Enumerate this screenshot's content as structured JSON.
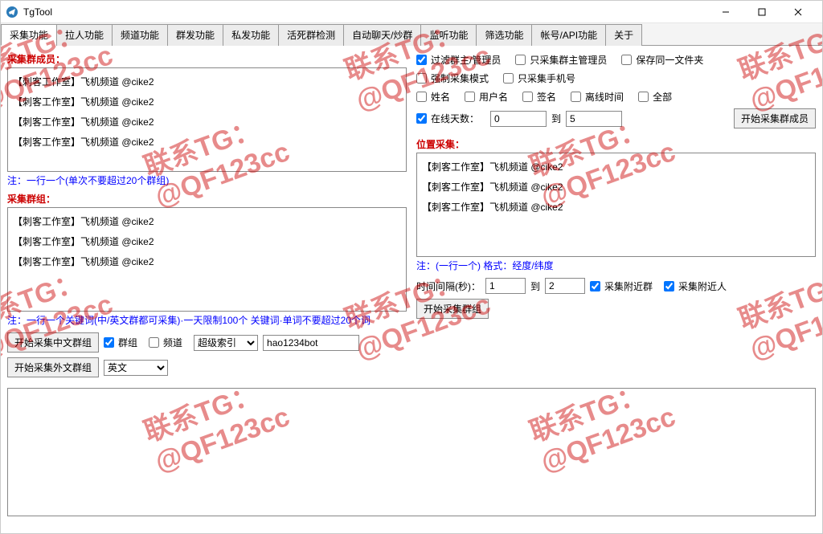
{
  "title": "TgTool",
  "tabs": [
    "采集功能",
    "拉人功能",
    "频道功能",
    "群发功能",
    "私发功能",
    "活死群检测",
    "自动聊天/炒群",
    "监听功能",
    "筛选功能",
    "帐号/API功能",
    "关于"
  ],
  "left": {
    "label_members": "采集群成员：",
    "list1_items": [
      "【刺客工作室】飞机频道 @cike2",
      "【刺客工作室】飞机频道 @cike2",
      "【刺客工作室】飞机频道 @cike2",
      "【刺客工作室】飞机频道 @cike2"
    ],
    "note1": "注：一行一个(单次不要超过20个群组)",
    "label_groups": "采集群组：",
    "list2_items": [
      "【刺客工作室】飞机频道 @cike2",
      "【刺客工作室】飞机频道 @cike2",
      "【刺客工作室】飞机频道 @cike2"
    ],
    "note2": "注：一行一个关键词(中/英文群都可采集)·一天限制100个 关键词·单词不要超过20个词",
    "btn_cn": "开始采集中文群组",
    "btn_en": "开始采集外文群组",
    "chk_group": "群组",
    "chk_channel": "频道",
    "sel_index": "超级索引",
    "bot_value": "hao1234bot",
    "lang_value": "英文"
  },
  "right": {
    "chk_filter_admin": "过滤群主/管理员",
    "chk_only_admin": "只采集群主管理员",
    "chk_same_folder": "保存同一文件夹",
    "chk_force": "强制采集模式",
    "chk_only_phone": "只采集手机号",
    "chk_name": "姓名",
    "chk_username": "用户名",
    "chk_signature": "签名",
    "chk_offline": "离线时间",
    "chk_all": "全部",
    "chk_online_days": "在线天数：",
    "days_from": "0",
    "days_to_label": "到",
    "days_to": "5",
    "btn_start_members": "开始采集群成员",
    "label_location": "位置采集：",
    "list3_items": [
      "【刺客工作室】飞机频道 @cike2",
      "【刺客工作室】飞机频道 @cike2",
      "【刺客工作室】飞机频道 @cike2"
    ],
    "note3": "注：(一行一个) 格式：经度/纬度",
    "interval_label": "时间间隔(秒)：",
    "interval_from": "1",
    "interval_to_label": "到",
    "interval_to": "2",
    "chk_nearby_group": "采集附近群",
    "chk_nearby_people": "采集附近人",
    "btn_start_groups": "开始采集群组"
  },
  "watermark": {
    "line1": "联系TG：",
    "line2": "@QF123cc"
  }
}
